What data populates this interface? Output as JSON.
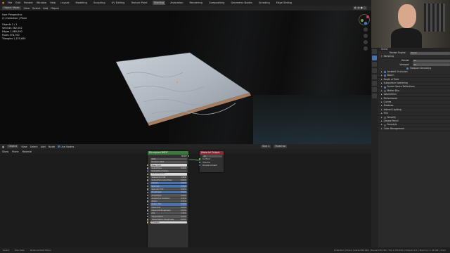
{
  "topbar": {
    "menus": [
      "File",
      "Edit",
      "Render",
      "Window",
      "Help"
    ],
    "tabs": [
      "Layout",
      "Modeling",
      "Sculpting",
      "UV Editing",
      "Texture Paint",
      "Shading",
      "Animation",
      "Rendering",
      "Compositing",
      "Geometry Nodes",
      "Scripting",
      "Edge Sliding"
    ],
    "active_tab": "Shading"
  },
  "viewport": {
    "mode": "Object Mode",
    "menus": [
      "View",
      "Select",
      "Add",
      "Object"
    ],
    "overlay_lines": [
      "User Perspective",
      "(1) Collection | Plane",
      "",
      "Objects   1 / 1",
      "Vertices  562,002",
      "Edges  1,680,000",
      "Faces  576,700",
      "Triangles  1,155,600"
    ]
  },
  "node_editor": {
    "mode": "Object",
    "menus": [
      "View",
      "Select",
      "Add",
      "Node"
    ],
    "use_nodes_label": "Use Nodes",
    "slot": "Slot 1",
    "material": "Material",
    "sub": [
      "Show",
      "Plane",
      "Material"
    ],
    "bsdf": {
      "title": "Principled BSDF",
      "out": "BSDF",
      "rows": [
        {
          "label": "GGX",
          "kind": "select"
        },
        {
          "label": "Random Walk",
          "kind": "select"
        },
        {
          "label": "Base Color",
          "kind": "color"
        },
        {
          "label": "Subsurface",
          "value": "0.000"
        },
        {
          "label": "Subsurface Radius",
          "kind": "vector"
        },
        {
          "label": "Subsurface Co...",
          "kind": "color"
        },
        {
          "label": "Subsurface IOR",
          "value": "1.400"
        },
        {
          "label": "Subsurface Anisotropy",
          "value": "0.000"
        },
        {
          "label": "Metallic",
          "value": "0.000",
          "blue": true
        },
        {
          "label": "Specular",
          "value": "0.500",
          "blue": true
        },
        {
          "label": "Specular Tint",
          "value": "0.000"
        },
        {
          "label": "Roughness",
          "value": "0.500",
          "blue": true
        },
        {
          "label": "Anisotropic",
          "value": "0.000"
        },
        {
          "label": "Anisotropic Rotation",
          "value": "0.000"
        },
        {
          "label": "Sheen",
          "value": "0.000"
        },
        {
          "label": "Sheen Tint",
          "value": "0.500",
          "blue": true
        },
        {
          "label": "Clearcoat",
          "value": "0.000"
        },
        {
          "label": "Clearcoat Roughness",
          "value": "0.030"
        },
        {
          "label": "IOR",
          "value": "1.450"
        },
        {
          "label": "Transmission",
          "value": "0.000"
        },
        {
          "label": "Transmission Roughness",
          "value": "0.000"
        },
        {
          "label": "Emission",
          "kind": "color"
        }
      ]
    },
    "output": {
      "title": "Material Output",
      "target": "All",
      "rows": [
        "Surface",
        "Volume",
        "Displacement"
      ]
    }
  },
  "properties": {
    "scene_label": "Scene",
    "render_engine_label": "Render Engine",
    "render_engine": "Eevee",
    "sampling": "Sampling",
    "render_label": "Render",
    "render_val": "64",
    "viewport_label": "Viewport",
    "viewport_val": "16",
    "denoise_label": "Viewport Denoising",
    "sections": [
      {
        "label": "Ambient Occlusion",
        "check": true
      },
      {
        "label": "Bloom",
        "check": true
      },
      {
        "label": "Depth of Field"
      },
      {
        "label": "Subsurface Scattering"
      },
      {
        "label": "Screen Space Reflections",
        "check": true
      },
      {
        "label": "Motion Blur",
        "check": false
      },
      {
        "label": "Volumetrics"
      },
      {
        "label": "Performance"
      },
      {
        "label": "Curves"
      },
      {
        "label": "Shadows"
      },
      {
        "label": "Indirect Lighting"
      },
      {
        "label": "Film"
      },
      {
        "label": "Simplify",
        "check": false
      },
      {
        "label": "Grease Pencil"
      },
      {
        "label": "Freestyle",
        "check": false
      },
      {
        "label": "Color Management"
      }
    ]
  },
  "statusbar": {
    "items": [
      "Select",
      "Pan View",
      "Node Context Menu"
    ],
    "stats": "Collection | Plane | Verts:562,002 | Faces:576,700 | Tris:1,155,600 | Objects:1/1 | Memory: 1.18 GiB | 3.0.0"
  }
}
